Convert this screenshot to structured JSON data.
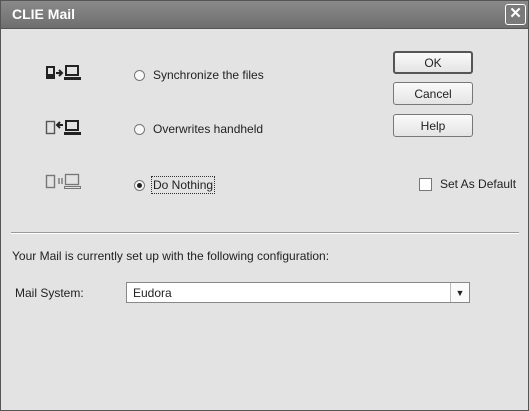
{
  "window": {
    "title": "CLIE Mail",
    "close_symbol": "✕"
  },
  "options": [
    {
      "label": "Synchronize the files",
      "icon": "sync-icon",
      "checked": false
    },
    {
      "label": "Overwrites handheld",
      "icon": "desktop-to-handheld-icon",
      "checked": false
    },
    {
      "label": "Do Nothing",
      "icon": "do-nothing-icon",
      "checked": true
    }
  ],
  "buttons": {
    "ok": "OK",
    "cancel": "Cancel",
    "help": "Help"
  },
  "set_default": {
    "label": "Set As Default",
    "checked": false
  },
  "config": {
    "message": "Your Mail is currently set up with the following configuration:",
    "mail_system_label": "Mail System:",
    "mail_system_value": "Eudora",
    "dropdown_arrow": "▼"
  }
}
